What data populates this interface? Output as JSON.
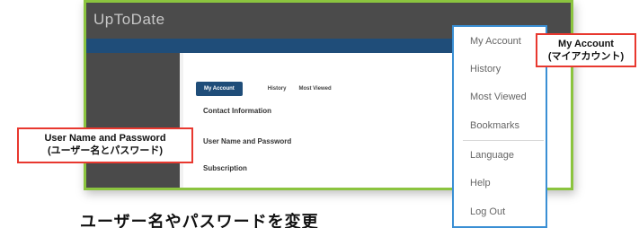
{
  "app": {
    "logo": "UpToDate"
  },
  "topbar": {
    "user": "",
    "extra": ""
  },
  "nav": {
    "items": [
      "",
      "",
      "",
      ""
    ]
  },
  "tabs": [
    {
      "label": "My Account",
      "active": true
    },
    {
      "label": "",
      "active": false
    },
    {
      "label": "History",
      "active": false
    },
    {
      "label": "Most Viewed",
      "active": false
    }
  ],
  "sections": [
    {
      "title": "Contact Information",
      "desc": ""
    },
    {
      "title": "User Name and Password",
      "desc": ""
    },
    {
      "title": "Subscription",
      "desc": ""
    }
  ],
  "dropdown": {
    "items": [
      "My Account",
      "History",
      "Most Viewed",
      "Bookmarks",
      "Language",
      "Help",
      "Log Out"
    ]
  },
  "callouts": {
    "left": {
      "line1": "User Name and Password",
      "line2": "(ユーザー名とパスワード)"
    },
    "right": {
      "line1": "My Account",
      "line2": "(マイアカウント)"
    }
  },
  "caption": "ユーザー名やパスワードを変更",
  "colors": {
    "frame": "#8bc43f",
    "dropdown_border": "#3a8fd4",
    "callout_border": "#e8382f",
    "nav": "#1f4d79"
  }
}
